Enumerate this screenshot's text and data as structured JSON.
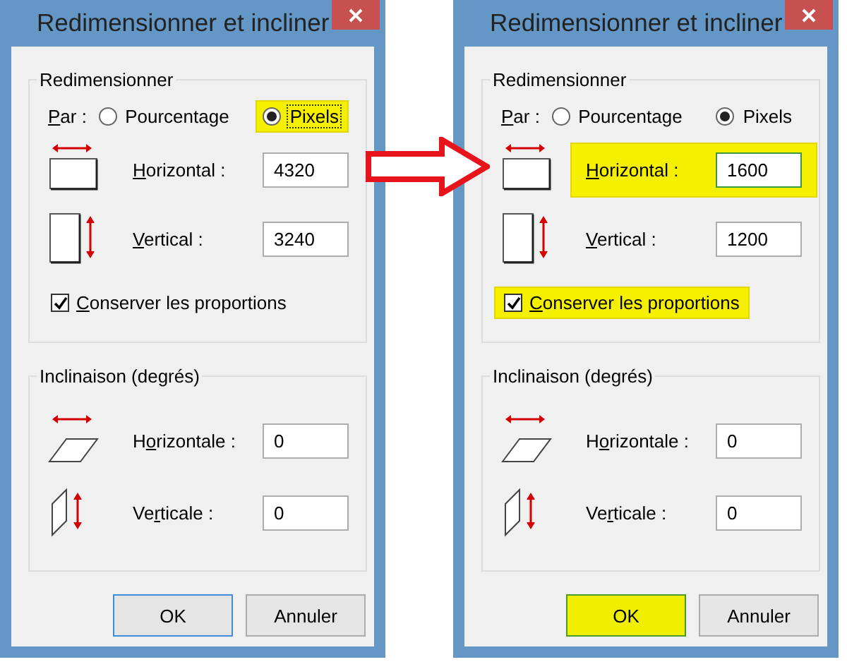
{
  "dialogs": [
    {
      "title": "Redimensionner et incliner",
      "resize": {
        "legend": "Redimensionner",
        "by_label": {
          "key": "P",
          "after": "ar :"
        },
        "options": [
          {
            "label": "Pourcentage",
            "selected": false,
            "focused": false,
            "highlighted": false
          },
          {
            "label": "Pixels",
            "selected": true,
            "focused": true,
            "highlighted": true
          }
        ],
        "fields": [
          {
            "kind": "horizontal",
            "label": {
              "key": "H",
              "after": "orizontal :"
            },
            "value": "4320",
            "focused": false,
            "highlighted": false
          },
          {
            "kind": "vertical",
            "label": {
              "key": "V",
              "after": "ertical :"
            },
            "value": "3240",
            "focused": false,
            "highlighted": false
          }
        ],
        "keep_ratio": {
          "label": {
            "key": "C",
            "after": "onserver les proportions"
          },
          "checked": true,
          "highlighted": false
        }
      },
      "skew": {
        "legend": "Inclinaison (degrés)",
        "fields": [
          {
            "kind": "horizontal",
            "label": {
              "before": "H",
              "key": "o",
              "after": "rizontale :"
            },
            "value": "0"
          },
          {
            "kind": "vertical",
            "label": {
              "before": "Ve",
              "key": "r",
              "after": "ticale :"
            },
            "value": "0"
          }
        ]
      },
      "buttons": [
        {
          "label": "OK",
          "default": true,
          "highlighted": false
        },
        {
          "label": "Annuler",
          "default": false,
          "highlighted": false
        }
      ]
    },
    {
      "title": "Redimensionner et incliner",
      "resize": {
        "legend": "Redimensionner",
        "by_label": {
          "key": "P",
          "after": "ar :"
        },
        "options": [
          {
            "label": "Pourcentage",
            "selected": false,
            "focused": false,
            "highlighted": false
          },
          {
            "label": "Pixels",
            "selected": true,
            "focused": false,
            "highlighted": false
          }
        ],
        "fields": [
          {
            "kind": "horizontal",
            "label": {
              "key": "H",
              "after": "orizontal :"
            },
            "value": "1600",
            "focused": true,
            "highlighted": true
          },
          {
            "kind": "vertical",
            "label": {
              "key": "V",
              "after": "ertical :"
            },
            "value": "1200",
            "focused": false,
            "highlighted": false
          }
        ],
        "keep_ratio": {
          "label": {
            "key": "C",
            "after": "onserver les proportions"
          },
          "checked": true,
          "highlighted": true
        }
      },
      "skew": {
        "legend": "Inclinaison (degrés)",
        "fields": [
          {
            "kind": "horizontal",
            "label": {
              "before": "H",
              "key": "o",
              "after": "rizontale :"
            },
            "value": "0"
          },
          {
            "kind": "vertical",
            "label": {
              "before": "Ve",
              "key": "r",
              "after": "ticale :"
            },
            "value": "0"
          }
        ]
      },
      "buttons": [
        {
          "label": "OK",
          "default": true,
          "highlighted": true
        },
        {
          "label": "Annuler",
          "default": false,
          "highlighted": false
        }
      ]
    }
  ]
}
